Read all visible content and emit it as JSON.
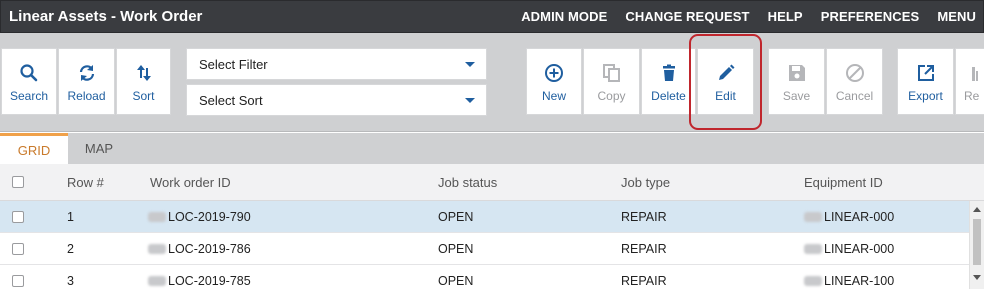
{
  "titlebar": {
    "title": "Linear Assets - Work Order",
    "menu": [
      "ADMIN MODE",
      "CHANGE REQUEST",
      "HELP",
      "PREFERENCES",
      "MENU"
    ]
  },
  "toolbar": {
    "search": {
      "label": "Search",
      "icon": "search-icon"
    },
    "reload": {
      "label": "Reload",
      "icon": "reload-icon"
    },
    "sort": {
      "label": "Sort",
      "icon": "sort-icon"
    },
    "filter_select": {
      "value": "Select Filter"
    },
    "sort_select": {
      "value": "Select Sort"
    },
    "new": {
      "label": "New",
      "icon": "plus-circle-icon"
    },
    "copy": {
      "label": "Copy",
      "icon": "copy-icon"
    },
    "delete": {
      "label": "Delete",
      "icon": "trash-icon"
    },
    "edit": {
      "label": "Edit",
      "icon": "pencil-icon"
    },
    "save": {
      "label": "Save",
      "icon": "floppy-icon"
    },
    "cancel": {
      "label": "Cancel",
      "icon": "cancel-icon"
    },
    "export": {
      "label": "Export",
      "icon": "export-icon"
    },
    "partial": {
      "label": "Re"
    }
  },
  "tabs": [
    {
      "label": "GRID",
      "active": true
    },
    {
      "label": "MAP",
      "active": false
    }
  ],
  "grid": {
    "columns": [
      "Row #",
      "Work order ID",
      "Job status",
      "Job type",
      "Equipment ID"
    ],
    "rows": [
      {
        "row": "1",
        "work_order_id": "LOC-2019-790",
        "job_status": "OPEN",
        "job_type": "REPAIR",
        "equipment_id": "LINEAR-000"
      },
      {
        "row": "2",
        "work_order_id": "LOC-2019-786",
        "job_status": "OPEN",
        "job_type": "REPAIR",
        "equipment_id": "LINEAR-000"
      },
      {
        "row": "3",
        "work_order_id": "LOC-2019-785",
        "job_status": "OPEN",
        "job_type": "REPAIR",
        "equipment_id": "LINEAR-100"
      }
    ]
  },
  "colors": {
    "titlebar": "#3a3c40",
    "accent_blue": "#1f5e9f",
    "highlight_red": "#c0262d",
    "tab_active": "#c97a2b",
    "selected_row": "#d6e6f2"
  }
}
